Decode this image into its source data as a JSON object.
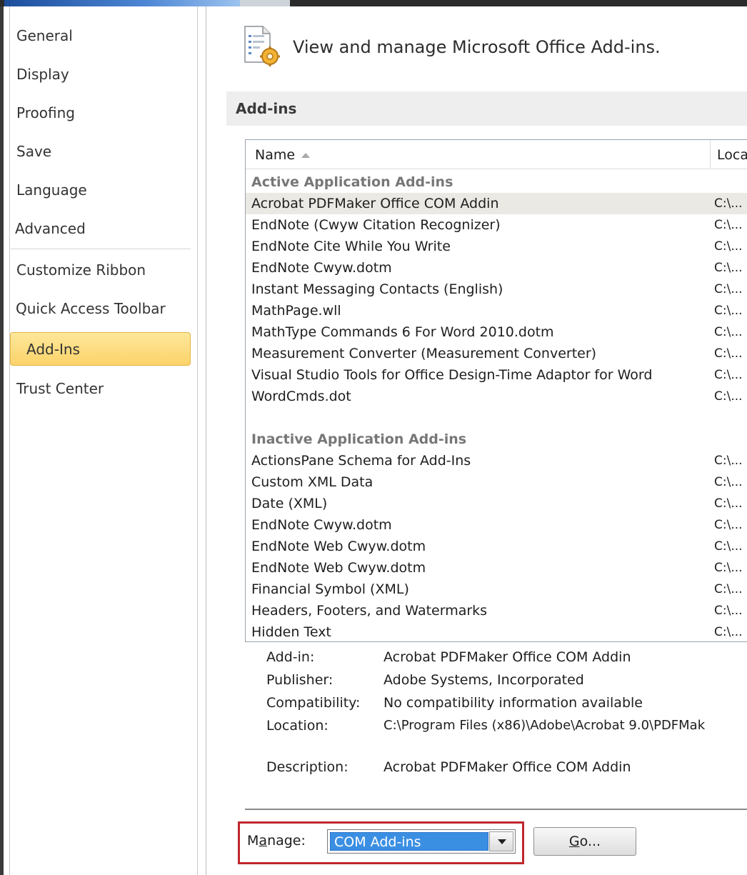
{
  "nav": {
    "items": [
      {
        "label": "General"
      },
      {
        "label": "Display"
      },
      {
        "label": "Proofing"
      },
      {
        "label": "Save"
      },
      {
        "label": "Language"
      },
      {
        "label": "Advanced"
      },
      {
        "label": "Customize Ribbon"
      },
      {
        "label": "Quick Access Toolbar"
      },
      {
        "label": "Add-Ins",
        "selected": true
      },
      {
        "label": "Trust Center"
      }
    ]
  },
  "header": {
    "icon": "addins-gear-icon",
    "title": "View and manage Microsoft Office Add-ins."
  },
  "section": {
    "title": "Add-ins"
  },
  "list": {
    "columns": {
      "name": "Name",
      "location": "Loca"
    },
    "active_group": "Active Application Add-ins",
    "active": [
      {
        "name": "Acrobat PDFMaker Office COM Addin",
        "location": "C:\\...",
        "selected": true
      },
      {
        "name": "EndNote (Cwyw Citation Recognizer)",
        "location": "C:\\...",
        "highlighted": true
      },
      {
        "name": "EndNote Cite While You Write",
        "location": "C:\\...",
        "highlighted": true
      },
      {
        "name": "EndNote Cwyw.dotm",
        "location": "C:\\...",
        "highlighted": true
      },
      {
        "name": "Instant Messaging Contacts (English)",
        "location": "C:\\..."
      },
      {
        "name": "MathPage.wll",
        "location": "C:\\..."
      },
      {
        "name": "MathType Commands 6 For Word 2010.dotm",
        "location": "C:\\..."
      },
      {
        "name": "Measurement Converter (Measurement Converter)",
        "location": "C:\\..."
      },
      {
        "name": "Visual Studio Tools for Office Design-Time Adaptor for Word",
        "location": "C:\\..."
      },
      {
        "name": "WordCmds.dot",
        "location": "C:\\..."
      }
    ],
    "inactive_group": "Inactive Application Add-ins",
    "inactive": [
      {
        "name": "ActionsPane Schema for Add-Ins",
        "location": "C:\\..."
      },
      {
        "name": "Custom XML Data",
        "location": "C:\\..."
      },
      {
        "name": "Date (XML)",
        "location": "C:\\..."
      },
      {
        "name": "EndNote Cwyw.dotm",
        "location": "C:\\..."
      },
      {
        "name": "EndNote Web Cwyw.dotm",
        "location": "C:\\..."
      },
      {
        "name": "EndNote Web Cwyw.dotm",
        "location": "C:\\..."
      },
      {
        "name": "Financial Symbol (XML)",
        "location": "C:\\..."
      },
      {
        "name": "Headers, Footers, and Watermarks",
        "location": "C:\\..."
      },
      {
        "name": "Hidden Text",
        "location": "C:\\..."
      }
    ],
    "highlight_color": "#80f080"
  },
  "details": {
    "addin_label": "Add-in:",
    "addin_value": "Acrobat PDFMaker Office COM Addin",
    "publisher_label": "Publisher:",
    "publisher_value": "Adobe Systems, Incorporated",
    "compat_label": "Compatibility:",
    "compat_value": "No compatibility information available",
    "location_label": "Location:",
    "location_value": "C:\\Program Files (x86)\\Adobe\\Acrobat 9.0\\PDFMak",
    "description_label": "Description:",
    "description_value": "Acrobat PDFMaker Office COM Addin"
  },
  "manage": {
    "label_pre": "M",
    "label_accel": "a",
    "label_post": "nage:",
    "selected": "COM Add-ins",
    "go_accel": "G",
    "go_rest": "o...",
    "highlight_color": "#c0272d"
  }
}
